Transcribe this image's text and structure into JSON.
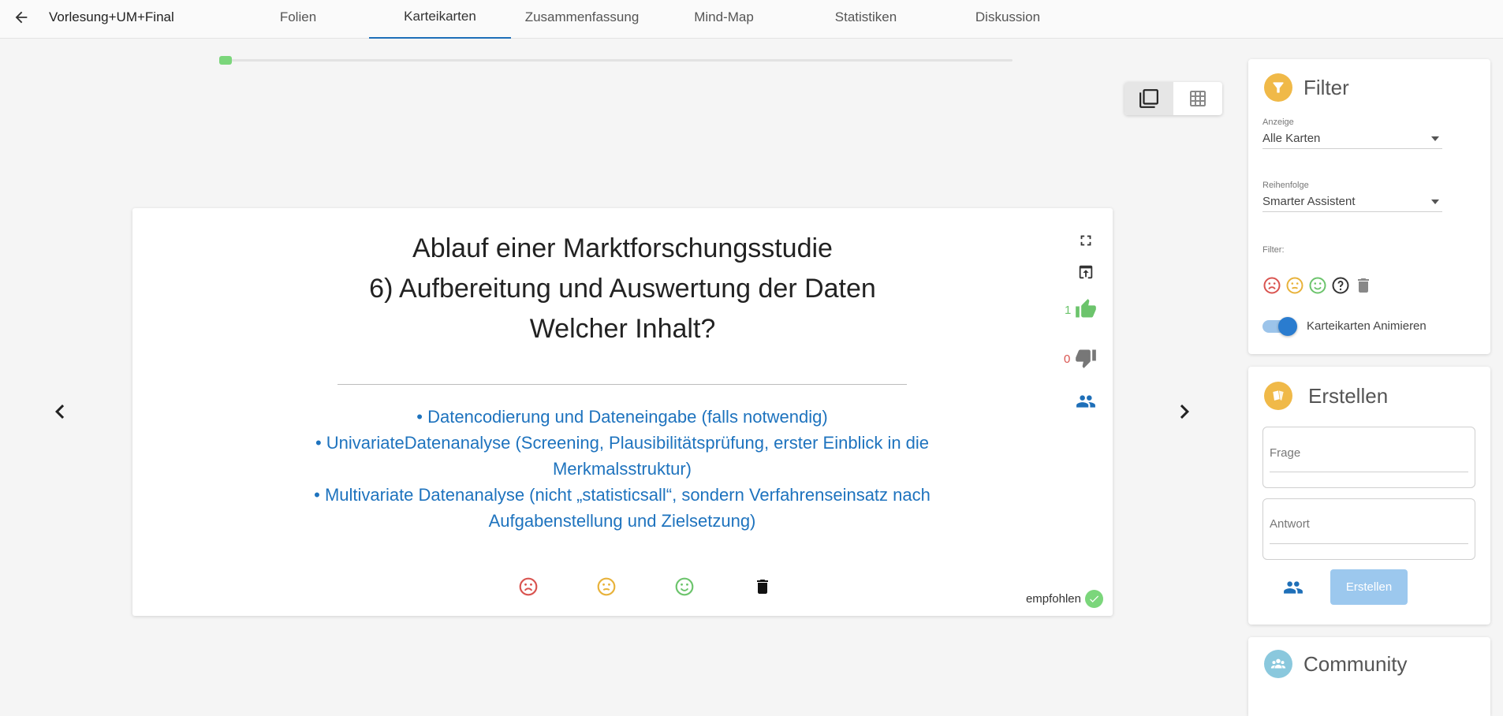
{
  "header": {
    "back_icon": "arrow-left-icon",
    "course_title": "Vorlesung+UM+Final",
    "tabs": [
      {
        "label": "Folien"
      },
      {
        "label": "Karteikarten"
      },
      {
        "label": "Zusammenfassung"
      },
      {
        "label": "Mind-Map"
      },
      {
        "label": "Statistiken"
      },
      {
        "label": "Diskussion"
      }
    ],
    "active_tab": "Karteikarten"
  },
  "progress": {
    "fraction": 0.016
  },
  "view_toggle": {
    "single_icon": "single-card-icon",
    "grid_icon": "grid-icon",
    "active": "single"
  },
  "card": {
    "question_lines": [
      "Ablauf einer Marktforschungsstudie",
      "6) Aufbereitung und Auswertung der Daten",
      "Welcher Inhalt?"
    ],
    "answer_lines": [
      "• Datencodierung und Dateneingabe (falls notwendig)",
      "• UnivariateDatenanalyse (Screening, Plausibilitätsprüfung, erster Einblick in die",
      "Merkmalsstruktur)",
      "• Multivariate Datenanalyse (nicht „statisticsall“, sondern Verfahrenseinsatz nach",
      "Aufgabenstellung und Zielsetzung)"
    ],
    "likes": "1",
    "dislikes": "0",
    "recommended_label": "empfohlen",
    "colors": {
      "sad": "#d9534f",
      "neutral": "#e8b23a",
      "happy": "#6cc46c",
      "like": "#6cc46c",
      "answer": "#1e73be"
    }
  },
  "filter_panel": {
    "title": "Filter",
    "anzeige_label": "Anzeige",
    "anzeige_value": "Alle Karten",
    "reihenfolge_label": "Reihenfolge",
    "reihenfolge_value": "Smarter Assistent",
    "filter_label": "Filter:",
    "animate_label": "Karteikarten Animieren",
    "animate_on": true
  },
  "create_panel": {
    "title": "Erstellen",
    "question_placeholder": "Frage",
    "answer_placeholder": "Antwort",
    "button_label": "Erstellen"
  },
  "community_panel": {
    "title": "Community"
  }
}
